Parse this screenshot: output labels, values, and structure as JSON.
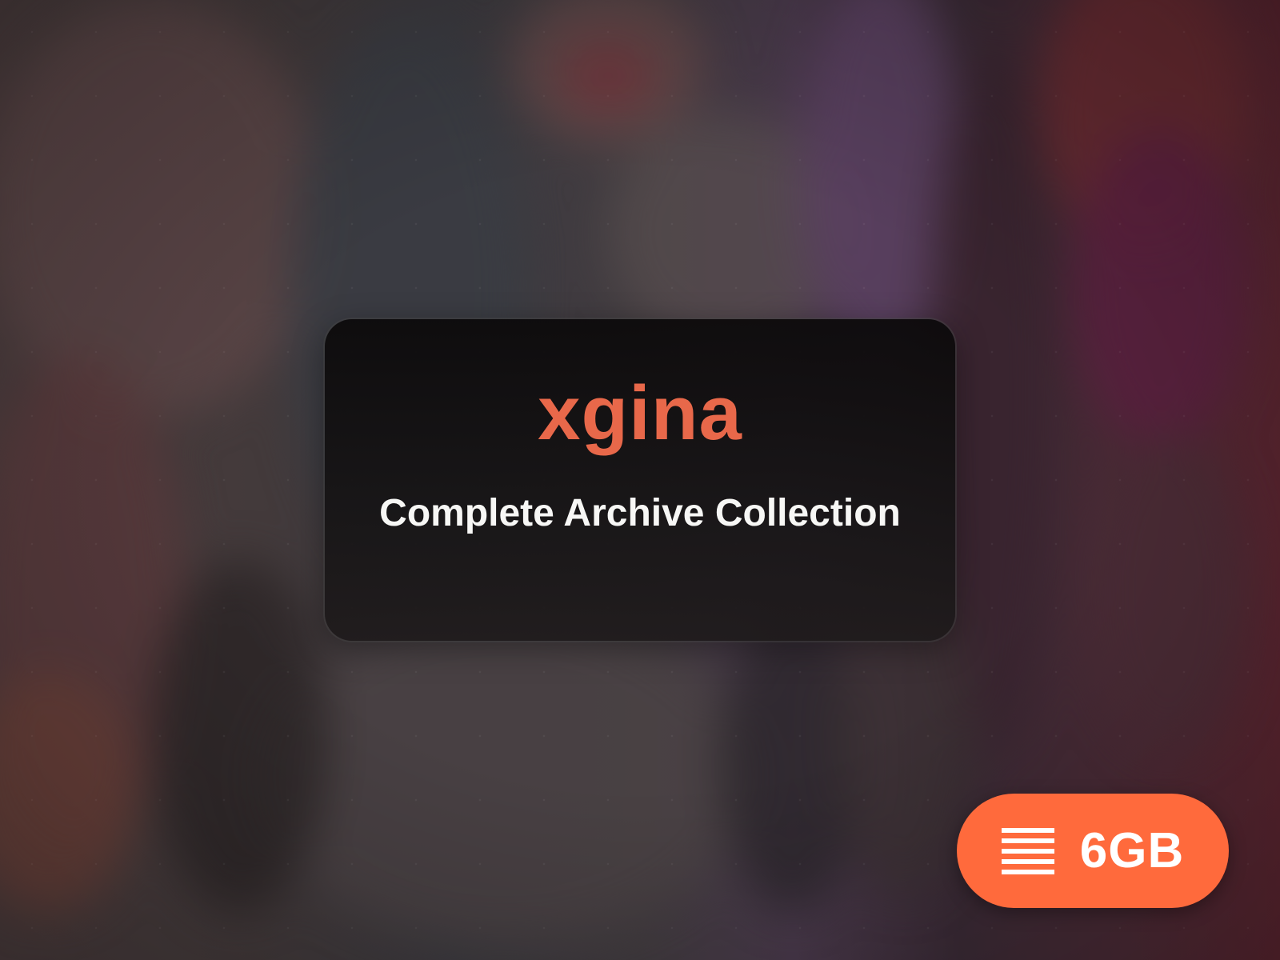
{
  "card": {
    "title": "xgina",
    "subtitle": "Complete Archive Collection"
  },
  "badge": {
    "size_text": "6GB",
    "icon": "lines-icon"
  },
  "colors": {
    "title_accent": "#e8684a",
    "badge_background": "#ff6a3c",
    "subtitle_text": "#f7f7f5"
  }
}
